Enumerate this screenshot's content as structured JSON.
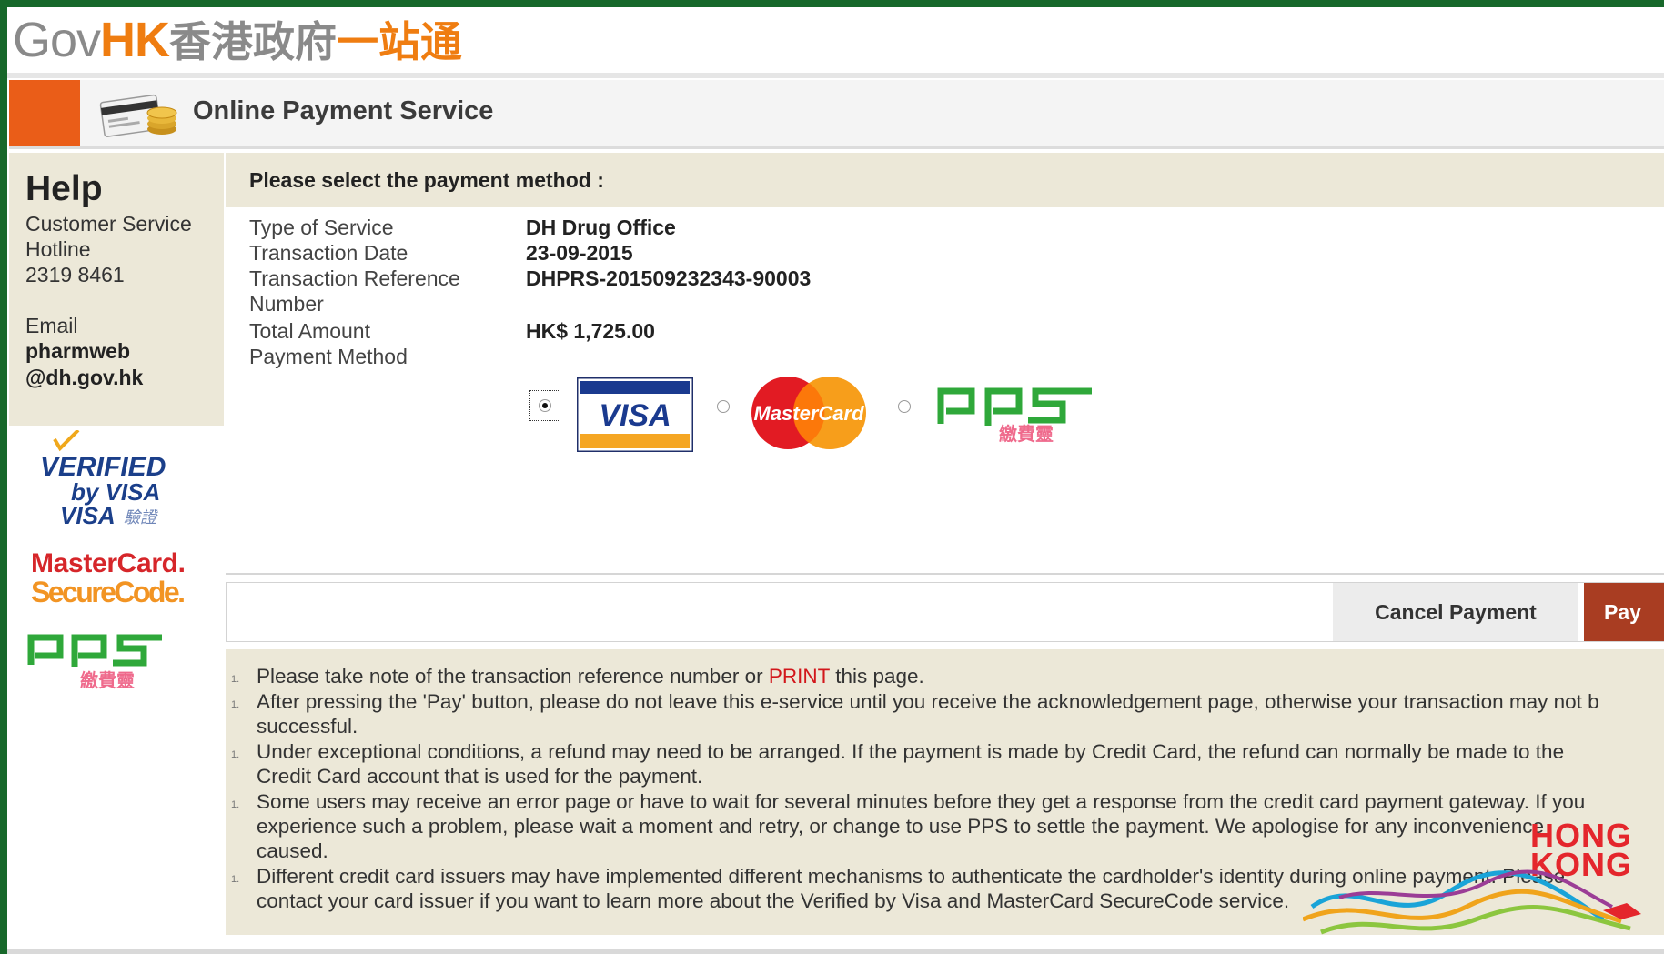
{
  "header": {
    "logo_gov": "Gov",
    "logo_hk": "HK",
    "logo_zh_gray": "香港政府",
    "logo_zh_orange": "一站通",
    "service_title": "Online Payment Service"
  },
  "help": {
    "title": "Help",
    "hotline_label_1": "Customer Service",
    "hotline_label_2": "Hotline",
    "hotline_number": "2319 8461",
    "email_label": "Email",
    "email_1": "pharmweb",
    "email_2": "@dh.gov.hk"
  },
  "badges": {
    "verified_1": "VERIFIED",
    "verified_2": "by VISA",
    "verified_3": "VISA",
    "verified_3_zh": "驗證",
    "securecode_1": "MasterCard.",
    "securecode_2": "SecureCode."
  },
  "payment": {
    "heading": "Please select the payment method :",
    "fields": [
      {
        "label": "Type of Service",
        "value": "DH Drug Office"
      },
      {
        "label": "Transaction Date",
        "value": "23-09-2015"
      },
      {
        "label": "Transaction Reference",
        "label2": "Number",
        "value": "DHPRS-201509232343-90003"
      },
      {
        "label": "Total Amount",
        "value": "HK$ 1,725.00"
      },
      {
        "label": "Payment Method"
      }
    ],
    "methods": [
      {
        "name": "VISA",
        "selected": true
      },
      {
        "name": "MasterCard",
        "selected": false
      },
      {
        "name": "pps",
        "name_zh": "繳費靈",
        "selected": false
      }
    ]
  },
  "actions": {
    "cancel_label": "Cancel Payment",
    "pay_label": "Pay"
  },
  "notes": {
    "bullet": "1.",
    "n1_a": "Please take note of the transaction reference number or",
    "n1_print": "PRINT",
    "n1_b": "this page.",
    "n2": "After pressing the 'Pay' button, please do not leave this e-service until you receive the acknowledgement page, otherwise your transaction may not b",
    "n2_cont": "successful.",
    "n3": "Under exceptional conditions, a refund may need to be arranged. If the payment is made by Credit Card, the refund can normally be made to the",
    "n3_cont": "Credit Card account that is used for the payment.",
    "n4": "Some users may receive an error page or have to wait for several minutes before they get a response from the credit card payment gateway. If you",
    "n4_cont": "experience such a problem, please wait a moment and retry, or change to use PPS to settle the payment. We apologise for any inconvenience",
    "n4_cont2": "caused.",
    "n5": "Different credit card issuers may have implemented different mechanisms to authenticate the cardholder's identity during online payment. Please",
    "n5_cont": "contact your card issuer if you want to learn more about the Verified by Visa and MasterCard SecureCode service."
  },
  "brand": {
    "line1": "HONG",
    "line2": "KONG"
  },
  "colors": {
    "frame_green": "#17682a",
    "gov_orange": "#ef7d11",
    "title_orange": "#ea5d18",
    "pay_red": "#a93d22",
    "panel_beige": "#ece8d8",
    "print_red": "#d2171b"
  }
}
